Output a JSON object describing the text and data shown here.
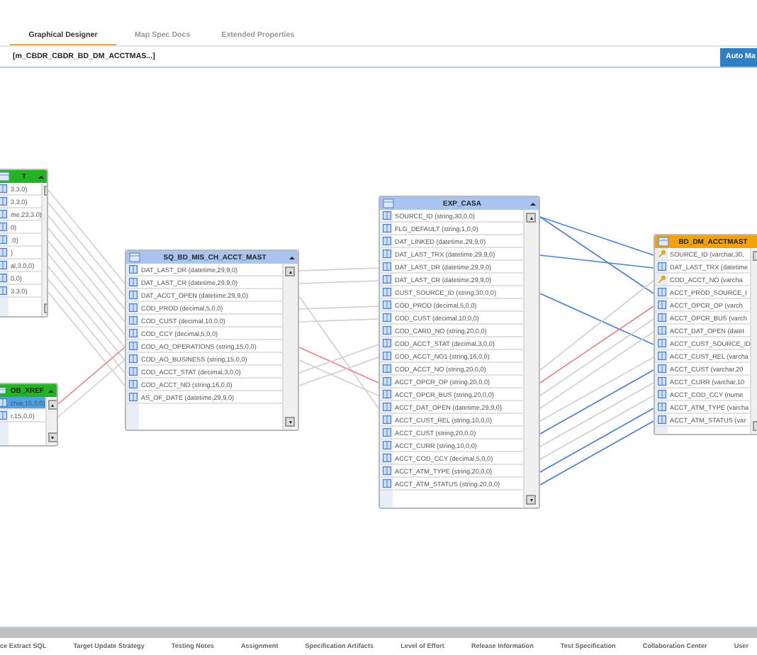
{
  "tabs": [
    {
      "label": "Graphical Designer",
      "selected": true
    },
    {
      "label": "Map Spec Docs",
      "selected": false
    },
    {
      "label": "Extended Properties",
      "selected": false
    }
  ],
  "mapping_title": "[m_CBDR_CBDR_BD_DM_ACCTMAS...]",
  "auto_button": "Auto Ma",
  "tables": [
    {
      "title": "T",
      "color": "#22b422",
      "rows": [
        {
          "text": "3.3.0)",
          "kind": "column",
          "selected": false
        },
        {
          "text": "3.3.0)",
          "kind": "column",
          "selected": false
        },
        {
          "text": "me,23,3.0)",
          "kind": "column",
          "selected": false
        },
        {
          "text": "0)",
          "kind": "column",
          "selected": false
        },
        {
          "text": ".0)",
          "kind": "column",
          "selected": false
        },
        {
          "text": ")",
          "kind": "column",
          "selected": false
        },
        {
          "text": "al,3.0,0)",
          "kind": "column",
          "selected": false
        },
        {
          "text": "0.0)",
          "kind": "column",
          "selected": false
        },
        {
          "text": "3.3.0)",
          "kind": "column",
          "selected": false
        }
      ]
    },
    {
      "title": "OB_XREF",
      "color": "#22b422",
      "rows": [
        {
          "text": "char,15,0,0)",
          "kind": "column",
          "selected": true
        },
        {
          "text": "r,15,0,0)",
          "kind": "column",
          "selected": false
        }
      ]
    },
    {
      "title": "SQ_BD_MIS_CH_ACCT_MAST",
      "color": "#a9c4ef",
      "rows": [
        {
          "text": "DAT_LAST_DR (datetime,29,9,0)",
          "kind": "column",
          "selected": false
        },
        {
          "text": "DAT_LAST_CR (datetime,29,9,0)",
          "kind": "column",
          "selected": false
        },
        {
          "text": "DAT_ACCT_OPEN (datetime,29,9,0)",
          "kind": "column",
          "selected": false
        },
        {
          "text": "COD_PROD (decimal,5,0,0)",
          "kind": "column",
          "selected": false
        },
        {
          "text": "COD_CUST (decimal,10,0,0)",
          "kind": "column",
          "selected": false
        },
        {
          "text": "COD_CCY (decimal,5,0,0)",
          "kind": "column",
          "selected": false
        },
        {
          "text": "COD_AO_OPERATIONS (string,15,0,0)",
          "kind": "column",
          "selected": false
        },
        {
          "text": "COD_AO_BUSINESS (string,15,0,0)",
          "kind": "column",
          "selected": false
        },
        {
          "text": "COD_ACCT_STAT (decimal,3,0,0)",
          "kind": "column",
          "selected": false
        },
        {
          "text": "COD_ACCT_NO (string,16,0,0)",
          "kind": "column",
          "selected": false
        },
        {
          "text": "AS_OF_DATE (datetime,29,9,0)",
          "kind": "column",
          "selected": false
        }
      ]
    },
    {
      "title": "EXP_CASA",
      "color": "#a9c4ef",
      "rows": [
        {
          "text": "SOURCE_ID (string,30,0,0)",
          "kind": "column",
          "selected": false
        },
        {
          "text": "FLG_DEFAULT (string,1,0,0)",
          "kind": "column",
          "selected": false
        },
        {
          "text": "DAT_LINKED (datetime,29,9,0)",
          "kind": "column",
          "selected": false
        },
        {
          "text": "DAT_LAST_TRX (datetime,29,9,0)",
          "kind": "column",
          "selected": false
        },
        {
          "text": "DAT_LAST_DR (datetime,29,9,0)",
          "kind": "column",
          "selected": false
        },
        {
          "text": "DAT_LAST_CR (datetime,29,9,0)",
          "kind": "column",
          "selected": false
        },
        {
          "text": "CUST_SOURCE_ID (string,30,0,0)",
          "kind": "column",
          "selected": false
        },
        {
          "text": "COD_PROD (decimal,5,0,0)",
          "kind": "column",
          "selected": false
        },
        {
          "text": "COD_CUST (decimal,10,0,0)",
          "kind": "column",
          "selected": false
        },
        {
          "text": "COD_CARD_NO (string,20,0,0)",
          "kind": "column",
          "selected": false
        },
        {
          "text": "COD_ACCT_STAT (decimal,3,0,0)",
          "kind": "column",
          "selected": false
        },
        {
          "text": "COD_ACCT_NO1 (string,16,0,0)",
          "kind": "column",
          "selected": false
        },
        {
          "text": "COD_ACCT_NO (string,20,0,0)",
          "kind": "column",
          "selected": false
        },
        {
          "text": "ACCT_OPCR_OP (string,20,0,0)",
          "kind": "column",
          "selected": false
        },
        {
          "text": "ACCT_OPCR_BUS (string,20,0,0)",
          "kind": "column",
          "selected": false
        },
        {
          "text": "ACCT_DAT_OPEN (datetime,29,9,0)",
          "kind": "column",
          "selected": false
        },
        {
          "text": "ACCT_CUST_REL (string,10,0,0)",
          "kind": "column",
          "selected": false
        },
        {
          "text": "ACCT_CUST (string,20,0,0)",
          "kind": "column",
          "selected": false
        },
        {
          "text": "ACCT_CURR (string,10,0,0)",
          "kind": "column",
          "selected": false
        },
        {
          "text": "ACCT_COD_CCY (decimal,5,0,0)",
          "kind": "column",
          "selected": false
        },
        {
          "text": "ACCT_ATM_TYPE (string,20,0,0)",
          "kind": "column",
          "selected": false
        },
        {
          "text": "ACCT_ATM_STATUS (string,20,0,0)",
          "kind": "column",
          "selected": false
        }
      ]
    },
    {
      "title": "BD_DM_ACCTMAST",
      "color": "#f0a30a",
      "rows": [
        {
          "text": "SOURCE_ID (varchar,30,",
          "kind": "key",
          "selected": false
        },
        {
          "text": "DAT_LAST_TRX (datetime",
          "kind": "column",
          "selected": false
        },
        {
          "text": "COD_ACCT_NO (varcha",
          "kind": "key",
          "selected": false
        },
        {
          "text": "ACCT_PROD_SOURCE_I",
          "kind": "column",
          "selected": false
        },
        {
          "text": "ACCT_OPCR_OP (varch",
          "kind": "column",
          "selected": false
        },
        {
          "text": "ACCT_OPCR_BUS (varch",
          "kind": "column",
          "selected": false
        },
        {
          "text": "ACCT_DAT_OPEN (datet",
          "kind": "column",
          "selected": false
        },
        {
          "text": "ACCT_CUST_SOURCE_ID",
          "kind": "column",
          "selected": false
        },
        {
          "text": "ACCT_CUST_REL (varcha",
          "kind": "column",
          "selected": false
        },
        {
          "text": "ACCT_CUST (varchar,20",
          "kind": "column",
          "selected": false
        },
        {
          "text": "ACCT_CURR (varchar,10",
          "kind": "column",
          "selected": false
        },
        {
          "text": "ACCT_COD_CCY (nume",
          "kind": "column",
          "selected": false
        },
        {
          "text": "ACCT_ATM_TYPE (varcha",
          "kind": "column",
          "selected": false
        },
        {
          "text": "ACCT_ATM_STATUS (var",
          "kind": "column",
          "selected": false
        }
      ]
    }
  ],
  "bottom_tabs": [
    {
      "label": "ce Extract SQL",
      "selected": false
    },
    {
      "label": "Target Update Strategy",
      "selected": false
    },
    {
      "label": "Testing Notes",
      "selected": false
    },
    {
      "label": "Assignment",
      "selected": false
    },
    {
      "label": "Specification Artifacts",
      "selected": false
    },
    {
      "label": "Level of Effort",
      "selected": false
    },
    {
      "label": "Release Information",
      "selected": false
    },
    {
      "label": "Test Specification",
      "selected": false
    },
    {
      "label": "Collaboration Center",
      "selected": false
    },
    {
      "label": "User",
      "selected": false
    }
  ]
}
